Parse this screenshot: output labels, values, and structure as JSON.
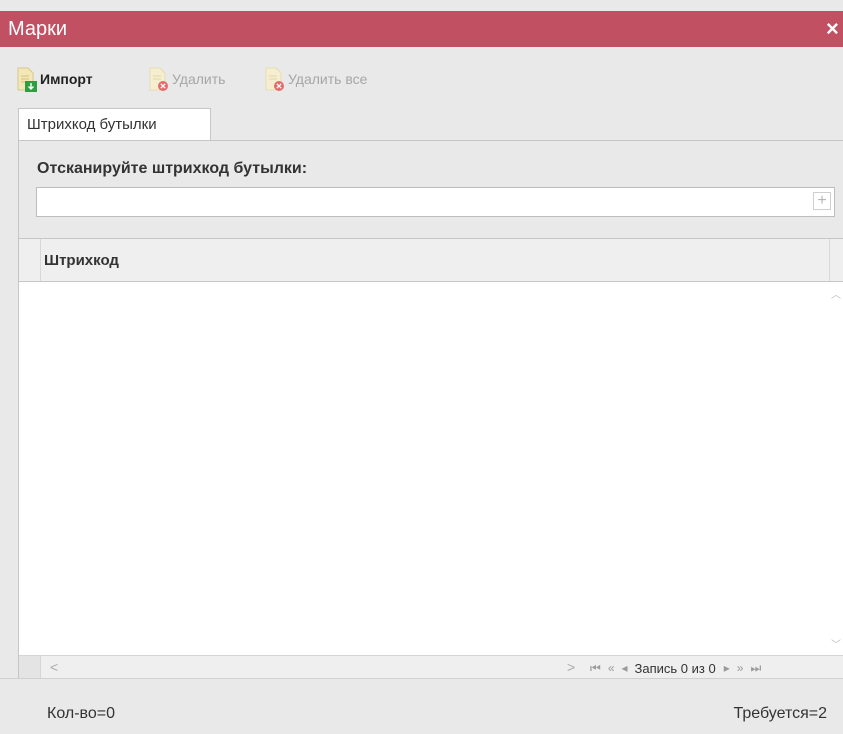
{
  "window": {
    "title": "Марки",
    "close_glyph": "×"
  },
  "toolbar": {
    "buttons": [
      {
        "label": "Импорт",
        "icon": "import-document-icon",
        "enabled": true
      },
      {
        "label": "Удалить",
        "icon": "delete-document-icon",
        "enabled": false
      },
      {
        "label": "Удалить все",
        "icon": "delete-all-document-icon",
        "enabled": false
      }
    ]
  },
  "tabs": [
    {
      "label": "Штрихкод бутылки",
      "active": true
    }
  ],
  "scan": {
    "label": "Отсканируйте штрихкод бутылки:",
    "value": "",
    "add_glyph": "+"
  },
  "grid": {
    "columns": [
      "Штрихкод"
    ],
    "rows": [],
    "pager": {
      "first": "⏮",
      "prev_page": "«",
      "prev": "◂",
      "record_info": "Запись 0 из 0",
      "next": "▸",
      "next_page": "»",
      "last": "⏭"
    },
    "hscroll": {
      "left": "<",
      "right": ">"
    }
  },
  "footer": {
    "count": "Кол-во=0",
    "required": "Требуется=2"
  },
  "colors": {
    "titlebar": "#c15063",
    "background": "#e9e9e9",
    "import_icon_badge": "#2e9e3f",
    "delete_icon_badge": "#e26b6b"
  }
}
